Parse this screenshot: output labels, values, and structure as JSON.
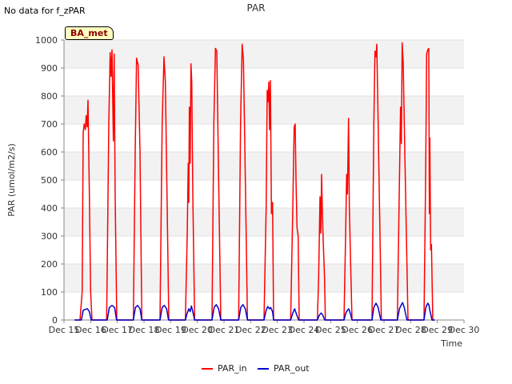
{
  "header": {
    "nodata_text": "No data for f_zPAR",
    "site_tag": "BA_met"
  },
  "chart_data": {
    "type": "line",
    "title": "PAR",
    "xlabel": "Time",
    "ylabel": "PAR (umol/m2/s)",
    "ylim": [
      0,
      1000
    ],
    "xlim": [
      15,
      30
    ],
    "yticks": [
      0,
      100,
      200,
      300,
      400,
      500,
      600,
      700,
      800,
      900,
      1000
    ],
    "xtick_labels": [
      "Dec 15",
      "Dec 16",
      "Dec 17",
      "Dec 18",
      "Dec 19",
      "Dec 20",
      "Dec 21",
      "Dec 22",
      "Dec 23",
      "Dec 24",
      "Dec 25",
      "Dec 26",
      "Dec 27",
      "Dec 28",
      "Dec 29",
      "Dec 30"
    ],
    "grid": "horizontal bands",
    "legend_position": "bottom-center",
    "series": [
      {
        "name": "PAR_in",
        "color": "#ff0000",
        "points": [
          [
            15.4,
            0
          ],
          [
            15.6,
            0
          ],
          [
            15.68,
            100
          ],
          [
            15.72,
            670
          ],
          [
            15.76,
            700
          ],
          [
            15.8,
            680
          ],
          [
            15.83,
            730
          ],
          [
            15.87,
            690
          ],
          [
            15.9,
            785
          ],
          [
            15.95,
            450
          ],
          [
            16.0,
            100
          ],
          [
            16.05,
            0
          ],
          [
            16.6,
            0
          ],
          [
            16.68,
            700
          ],
          [
            16.73,
            955
          ],
          [
            16.77,
            870
          ],
          [
            16.8,
            965
          ],
          [
            16.85,
            640
          ],
          [
            16.88,
            950
          ],
          [
            16.92,
            430
          ],
          [
            16.98,
            0
          ],
          [
            17.6,
            0
          ],
          [
            17.67,
            600
          ],
          [
            17.72,
            935
          ],
          [
            17.78,
            910
          ],
          [
            17.85,
            600
          ],
          [
            17.92,
            0
          ],
          [
            18.6,
            0
          ],
          [
            18.68,
            700
          ],
          [
            18.75,
            940
          ],
          [
            18.8,
            850
          ],
          [
            18.87,
            400
          ],
          [
            18.93,
            0
          ],
          [
            19.55,
            0
          ],
          [
            19.62,
            300
          ],
          [
            19.66,
            560
          ],
          [
            19.68,
            420
          ],
          [
            19.7,
            760
          ],
          [
            19.73,
            560
          ],
          [
            19.76,
            915
          ],
          [
            19.79,
            850
          ],
          [
            19.83,
            450
          ],
          [
            19.9,
            0
          ],
          [
            20.55,
            0
          ],
          [
            20.62,
            700
          ],
          [
            20.68,
            970
          ],
          [
            20.73,
            960
          ],
          [
            20.8,
            500
          ],
          [
            20.88,
            0
          ],
          [
            21.55,
            0
          ],
          [
            21.62,
            700
          ],
          [
            21.68,
            985
          ],
          [
            21.73,
            930
          ],
          [
            21.8,
            500
          ],
          [
            21.88,
            0
          ],
          [
            22.5,
            0
          ],
          [
            22.58,
            400
          ],
          [
            22.62,
            820
          ],
          [
            22.65,
            780
          ],
          [
            22.68,
            850
          ],
          [
            22.71,
            680
          ],
          [
            22.74,
            855
          ],
          [
            22.78,
            380
          ],
          [
            22.82,
            420
          ],
          [
            22.86,
            0
          ],
          [
            23.5,
            0
          ],
          [
            23.58,
            400
          ],
          [
            23.63,
            690
          ],
          [
            23.67,
            700
          ],
          [
            23.7,
            500
          ],
          [
            23.74,
            330
          ],
          [
            23.78,
            300
          ],
          [
            23.82,
            0
          ],
          [
            24.5,
            0
          ],
          [
            24.55,
            150
          ],
          [
            24.6,
            440
          ],
          [
            24.63,
            310
          ],
          [
            24.66,
            520
          ],
          [
            24.69,
            380
          ],
          [
            24.73,
            260
          ],
          [
            24.77,
            150
          ],
          [
            24.8,
            0
          ],
          [
            25.5,
            0
          ],
          [
            25.56,
            300
          ],
          [
            25.6,
            520
          ],
          [
            25.63,
            450
          ],
          [
            25.67,
            720
          ],
          [
            25.7,
            400
          ],
          [
            25.75,
            200
          ],
          [
            25.8,
            0
          ],
          [
            26.55,
            0
          ],
          [
            26.62,
            700
          ],
          [
            26.66,
            960
          ],
          [
            26.7,
            940
          ],
          [
            26.73,
            985
          ],
          [
            26.78,
            700
          ],
          [
            26.85,
            300
          ],
          [
            26.9,
            0
          ],
          [
            27.5,
            0
          ],
          [
            27.58,
            500
          ],
          [
            27.62,
            760
          ],
          [
            27.65,
            630
          ],
          [
            27.68,
            990
          ],
          [
            27.72,
            920
          ],
          [
            27.78,
            600
          ],
          [
            27.84,
            300
          ],
          [
            27.9,
            0
          ],
          [
            28.5,
            0
          ],
          [
            28.56,
            500
          ],
          [
            28.6,
            950
          ],
          [
            28.64,
            965
          ],
          [
            28.68,
            970
          ],
          [
            28.7,
            380
          ],
          [
            28.72,
            650
          ],
          [
            28.75,
            250
          ],
          [
            28.78,
            270
          ],
          [
            28.83,
            0
          ],
          [
            28.9,
            0
          ]
        ]
      },
      {
        "name": "PAR_out",
        "color": "#0000cc",
        "points": [
          [
            15.4,
            0
          ],
          [
            15.65,
            0
          ],
          [
            15.72,
            35
          ],
          [
            15.8,
            38
          ],
          [
            15.88,
            40
          ],
          [
            15.95,
            30
          ],
          [
            16.02,
            0
          ],
          [
            16.62,
            0
          ],
          [
            16.7,
            45
          ],
          [
            16.8,
            52
          ],
          [
            16.9,
            45
          ],
          [
            16.97,
            0
          ],
          [
            17.6,
            0
          ],
          [
            17.68,
            45
          ],
          [
            17.76,
            52
          ],
          [
            17.85,
            40
          ],
          [
            17.92,
            0
          ],
          [
            18.6,
            0
          ],
          [
            18.68,
            45
          ],
          [
            18.76,
            52
          ],
          [
            18.85,
            40
          ],
          [
            18.92,
            0
          ],
          [
            19.55,
            0
          ],
          [
            19.62,
            25
          ],
          [
            19.68,
            40
          ],
          [
            19.73,
            30
          ],
          [
            19.78,
            50
          ],
          [
            19.83,
            30
          ],
          [
            19.9,
            0
          ],
          [
            20.55,
            0
          ],
          [
            20.63,
            45
          ],
          [
            20.71,
            55
          ],
          [
            20.8,
            40
          ],
          [
            20.88,
            0
          ],
          [
            21.55,
            0
          ],
          [
            21.63,
            45
          ],
          [
            21.71,
            55
          ],
          [
            21.8,
            40
          ],
          [
            21.88,
            0
          ],
          [
            22.5,
            0
          ],
          [
            22.58,
            35
          ],
          [
            22.64,
            48
          ],
          [
            22.7,
            40
          ],
          [
            22.75,
            45
          ],
          [
            22.82,
            30
          ],
          [
            22.86,
            0
          ],
          [
            23.5,
            0
          ],
          [
            23.58,
            25
          ],
          [
            23.65,
            40
          ],
          [
            23.72,
            20
          ],
          [
            23.8,
            0
          ],
          [
            24.5,
            0
          ],
          [
            24.58,
            18
          ],
          [
            24.64,
            25
          ],
          [
            24.7,
            18
          ],
          [
            24.78,
            0
          ],
          [
            25.5,
            0
          ],
          [
            25.57,
            25
          ],
          [
            25.63,
            35
          ],
          [
            25.68,
            40
          ],
          [
            25.75,
            20
          ],
          [
            25.8,
            0
          ],
          [
            26.55,
            0
          ],
          [
            26.62,
            45
          ],
          [
            26.7,
            60
          ],
          [
            26.78,
            45
          ],
          [
            26.88,
            0
          ],
          [
            27.5,
            0
          ],
          [
            27.58,
            40
          ],
          [
            27.65,
            55
          ],
          [
            27.7,
            62
          ],
          [
            27.76,
            45
          ],
          [
            27.86,
            0
          ],
          [
            28.5,
            0
          ],
          [
            28.57,
            45
          ],
          [
            28.64,
            60
          ],
          [
            28.68,
            55
          ],
          [
            28.72,
            35
          ],
          [
            28.8,
            0
          ],
          [
            28.9,
            0
          ]
        ]
      }
    ]
  }
}
